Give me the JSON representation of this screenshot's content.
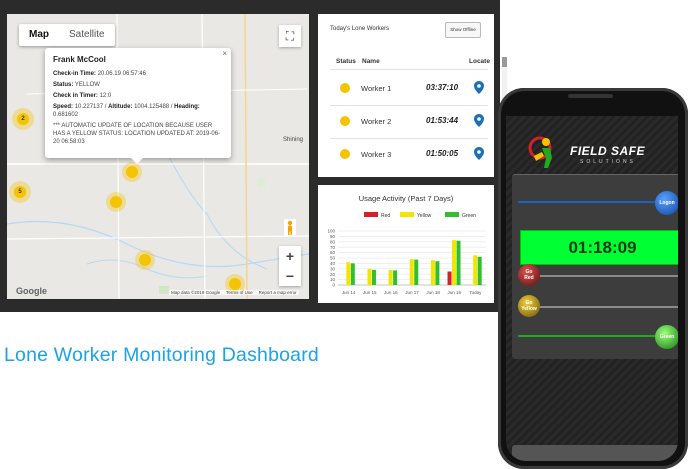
{
  "map": {
    "tabs": [
      {
        "label": "Map",
        "selected": true
      },
      {
        "label": "Satellite",
        "selected": false
      }
    ],
    "fullscreen_icon": "fullscreen-icon",
    "zoom_in": "+",
    "zoom_out": "−",
    "cluster_labels": [
      "2",
      "5"
    ],
    "place_label": "Shining",
    "google_label": "Google",
    "footer": [
      "Map data ©2019 Google",
      "Terms of Use",
      "Report a map error"
    ],
    "popup": {
      "close": "×",
      "name": "Frank McCool",
      "checkin_time_label": "Check-in Time:",
      "checkin_time": "20.06.19 06:57:46",
      "status_label": "Status:",
      "status": "YELLOW",
      "checkin_timer_label": "Check in Timer:",
      "checkin_timer": "12:0",
      "speed_label": "Speed:",
      "speed": "10.227137",
      "altitude_label": "Altitude:",
      "altitude": "1004.125488",
      "heading_label": "Heading:",
      "heading": "0.681602",
      "message": "*** AUTOMATIC UPDATE OF LOCATION BECAUSE USER HAS A YELLOW STATUS: LOCATION UPDATED AT: 2019-06-20 06:58:03"
    }
  },
  "workers": {
    "title": "Today's Lone Workers",
    "show_offline": "Show Offline",
    "columns": {
      "status": "Status",
      "name": "Name",
      "locate": "Locate"
    },
    "rows": [
      {
        "name": "Worker 1",
        "time": "03:37:10",
        "status_color": "#f5c400"
      },
      {
        "name": "Worker 2",
        "time": "01:53:44",
        "status_color": "#f5c400"
      },
      {
        "name": "Worker 3",
        "time": "01:50:05",
        "status_color": "#f5c400"
      }
    ]
  },
  "chart_data": {
    "type": "bar",
    "title": "Usage Activity (Past 7 Days)",
    "categories": [
      "Jun 14",
      "Jun 15",
      "Jun 16",
      "Jun 17",
      "Jun 18",
      "Jun 19",
      "Today"
    ],
    "series": [
      {
        "name": "Red",
        "color": "#d42027",
        "values": [
          0,
          0,
          0,
          0,
          0,
          25,
          0
        ]
      },
      {
        "name": "Yellow",
        "color": "#f2e600",
        "values": [
          42,
          30,
          28,
          48,
          46,
          83,
          55
        ]
      },
      {
        "name": "Green",
        "color": "#2fbf2f",
        "values": [
          40,
          28,
          27,
          47,
          44,
          82,
          52
        ]
      }
    ],
    "ylim": [
      0,
      100
    ],
    "yticks": [
      "100",
      "90",
      "80",
      "70",
      "60",
      "50",
      "40",
      "30",
      "20",
      "10",
      "0"
    ],
    "grid": true,
    "legend": "top"
  },
  "heading": "Lone Worker Monitoring Dashboard",
  "phone": {
    "brand": "FIELD SAFE",
    "brand_sub": "SOLUTIONS",
    "logon_label": "Logon",
    "timer": "01:18:09",
    "go_red_label": [
      "Go",
      "Red"
    ],
    "go_yellow_label": [
      "Go",
      "Yellow"
    ],
    "go_green_label": "Green",
    "colors": {
      "timer": "#00ff33",
      "logon": "#1565c0",
      "red": "#8b1a1a",
      "yellow": "#b08a00",
      "green": "#1faa1f"
    }
  }
}
